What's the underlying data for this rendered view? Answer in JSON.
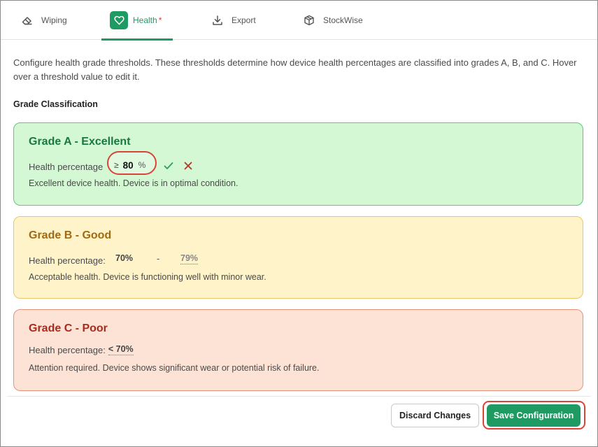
{
  "tabs": {
    "wiping": {
      "label": "Wiping",
      "icon": "eraser-icon"
    },
    "health": {
      "label": "Health",
      "marker": "*",
      "icon": "heart-icon"
    },
    "export": {
      "label": "Export",
      "icon": "download-icon"
    },
    "stockwise": {
      "label": "StockWise",
      "icon": "box-icon"
    }
  },
  "intro_text": "Configure health grade thresholds. These thresholds determine how device health percentages are classified into grades A, B, and C. Hover over a threshold value to edit it.",
  "section_title": "Grade Classification",
  "grades": {
    "a": {
      "title": "Grade A - Excellent",
      "hp_label": "Health percentage",
      "operator": "≥",
      "value": "80",
      "unit": "%",
      "description": "Excellent device health. Device is in optimal condition."
    },
    "b": {
      "title": "Grade B - Good",
      "hp_label": "Health percentage:",
      "low": "70%",
      "dash": "-",
      "high": "79%",
      "description": "Acceptable health. Device is functioning well with minor wear."
    },
    "c": {
      "title": "Grade C - Poor",
      "hp_label": "Health percentage:",
      "value": "< 70%",
      "description": "Attention required. Device shows significant wear or potential risk of failure."
    }
  },
  "footer": {
    "discard_label": "Discard Changes",
    "save_label": "Save Configuration"
  },
  "colors": {
    "accent": "#1f9a63",
    "highlight_ring": "#d9443a",
    "grade_a_bg": "#d4f8d3",
    "grade_b_bg": "#fef3c9",
    "grade_c_bg": "#fde3d6"
  }
}
